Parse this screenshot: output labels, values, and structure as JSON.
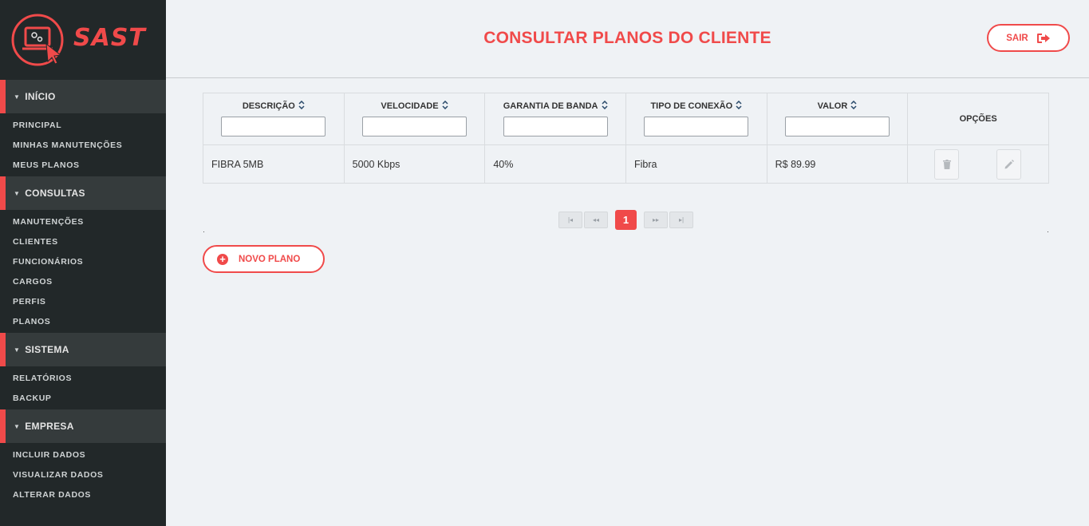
{
  "brand": {
    "name": "SAST",
    "accent": "#f04a4a"
  },
  "header": {
    "title": "CONSULTAR PLANOS DO CLIENTE",
    "logout_label": "SAIR"
  },
  "sidebar": {
    "sections": [
      {
        "title": "INÍCIO",
        "items": [
          "PRINCIPAL",
          "MINHAS MANUTENÇÕES",
          "MEUS PLANOS"
        ]
      },
      {
        "title": "CONSULTAS",
        "items": [
          "MANUTENÇÕES",
          "CLIENTES",
          "FUNCIONÁRIOS",
          "CARGOS",
          "PERFIS",
          "PLANOS"
        ]
      },
      {
        "title": "SISTEMA",
        "items": [
          "RELATÓRIOS",
          "BACKUP"
        ]
      },
      {
        "title": "EMPRESA",
        "items": [
          "INCLUIR DADOS",
          "VISUALIZAR DADOS",
          "ALTERAR DADOS"
        ]
      }
    ]
  },
  "table": {
    "columns": [
      "DESCRIÇÃO",
      "VELOCIDADE",
      "GARANTIA DE BANDA",
      "TIPO DE CONEXÃO",
      "VALOR"
    ],
    "options_header": "OPÇÕES",
    "filters": [
      "",
      "",
      "",
      "",
      ""
    ],
    "rows": [
      {
        "descricao": "FIBRA 5MB",
        "velocidade": "5000 Kbps",
        "garantia": "40%",
        "tipo": "Fibra",
        "valor": "R$ 89.99"
      }
    ]
  },
  "paginator": {
    "current_page": "1"
  },
  "actions": {
    "new_plan_label": "NOVO PLANO"
  }
}
